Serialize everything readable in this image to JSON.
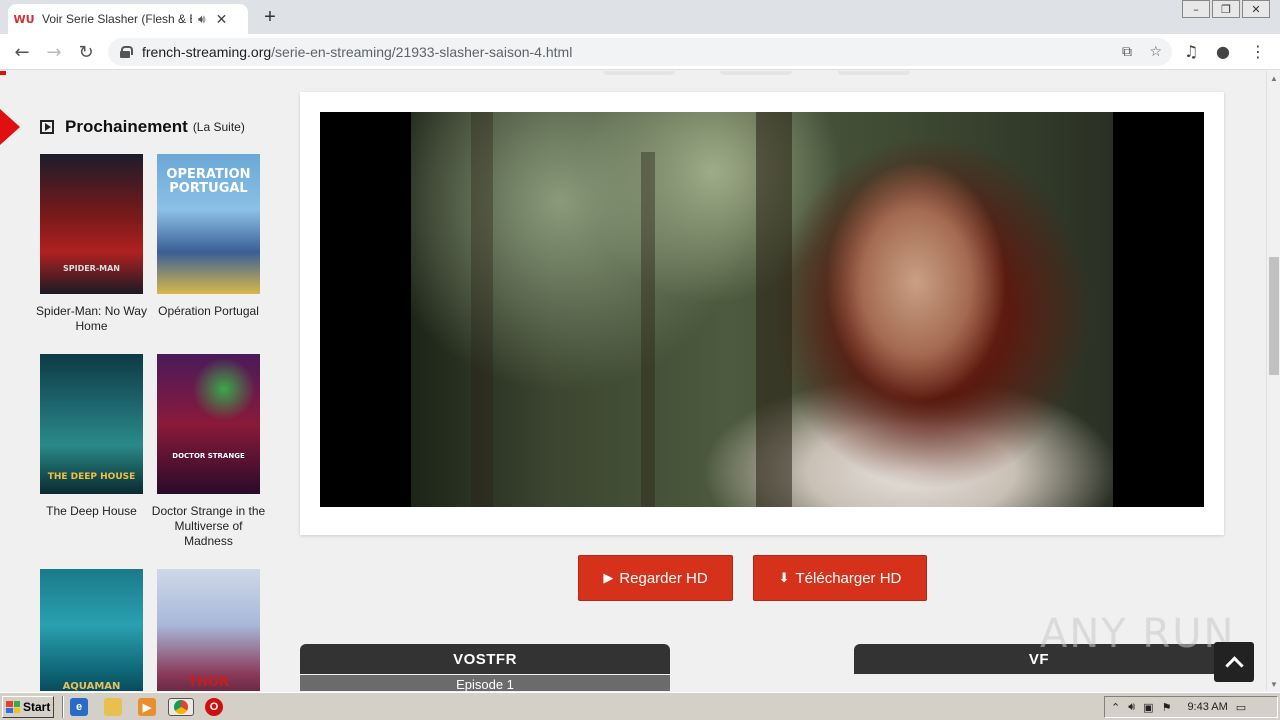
{
  "browser": {
    "tab_title": "Voir Serie Slasher (Flesh & Blood",
    "tab_favicon": "WU",
    "url_domain": "french-streaming.org",
    "url_path": "/serie-en-streaming/21933-slasher-saison-4.html"
  },
  "sidebar": {
    "title": "Prochainement",
    "subtitle": "(La Suite)",
    "posters": [
      {
        "caption": "Spider-Man: No Way Home",
        "art": "SPIDER-MAN"
      },
      {
        "caption": "Opération Portugal",
        "art": "OPERATION PORTUGAL"
      },
      {
        "caption": "The Deep House",
        "art": "THE DEEP HOUSE"
      },
      {
        "caption": "Doctor Strange in the Multiverse of Madness",
        "art": "DOCTOR STRANGE"
      },
      {
        "caption": "",
        "art": "AQUAMAN"
      },
      {
        "caption": "",
        "art": "THOR"
      }
    ]
  },
  "actions": {
    "watch_label": "Regarder HD",
    "download_label": "Télécharger HD"
  },
  "episodes": {
    "vostfr_header": "VOSTFR",
    "vf_header": "VF",
    "vostfr_items": [
      "Episode 1"
    ]
  },
  "watermark": "ANY RUN",
  "taskbar": {
    "start_label": "Start",
    "clock": "9:43 AM"
  },
  "colors": {
    "accent_red": "#d6321b",
    "marker_red": "#e01010",
    "episode_header": "#333333"
  }
}
